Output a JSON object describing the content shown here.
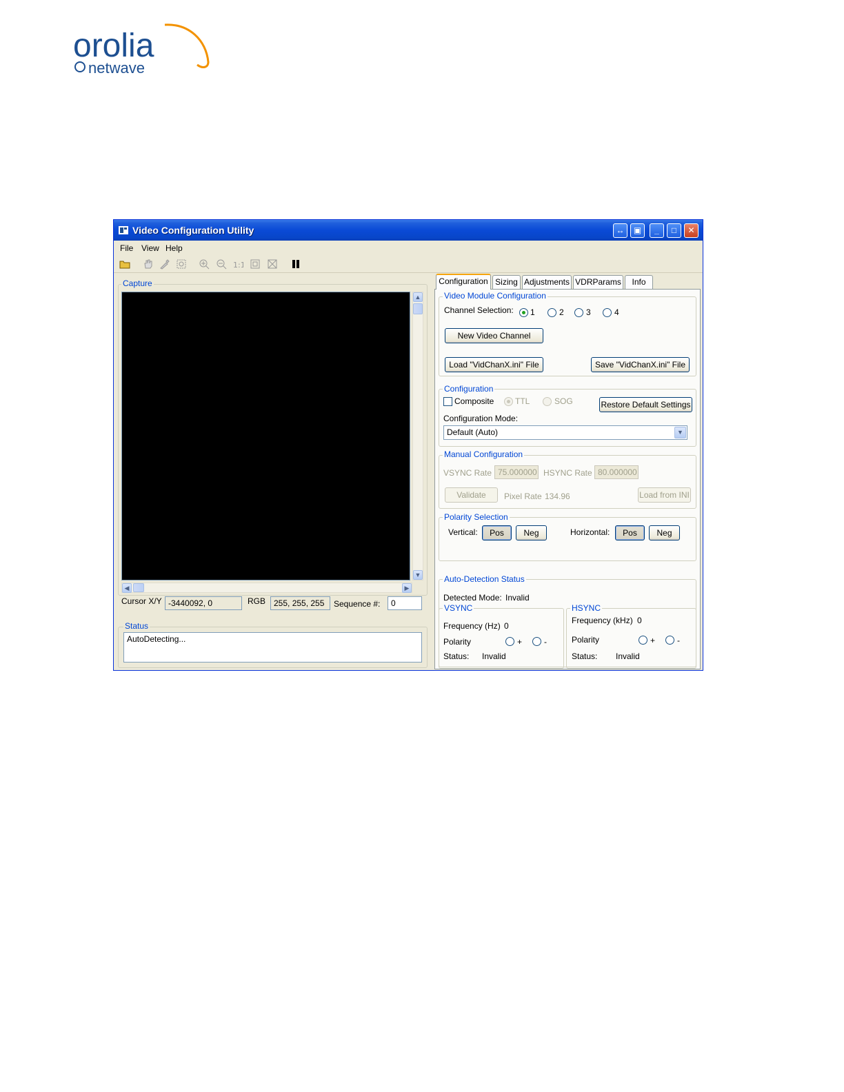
{
  "brand": {
    "name": "orolia",
    "subname": "netwave",
    "colors": {
      "blue": "#1d4f91",
      "orange": "#f39200"
    }
  },
  "window": {
    "title": "Video Configuration Utility",
    "controls": [
      "restore-arrows-icon",
      "window-icon",
      "minimize-icon",
      "maximize-icon",
      "close-icon"
    ]
  },
  "menu": {
    "file": "File",
    "view": "View",
    "help": "Help"
  },
  "toolbar": {
    "icons": [
      "open-folder-icon",
      "hand-pan-icon",
      "eyedropper-icon",
      "zoom-region-icon",
      "zoom-in-icon",
      "zoom-out-icon",
      "actual-size-icon",
      "fit-icon",
      "fullscreen-icon",
      "pause-icon"
    ]
  },
  "capture": {
    "label": "Capture",
    "cursor_label": "Cursor X/Y",
    "cursor_value": "-3440092, 0",
    "rgb_label": "RGB",
    "rgb_value": "255, 255, 255",
    "sequence_label": "Sequence #:",
    "sequence_value": "0"
  },
  "status": {
    "label": "Status",
    "text": "AutoDetecting..."
  },
  "tabs": [
    "Configuration",
    "Sizing",
    "Adjustments",
    "VDRParams",
    "Info"
  ],
  "video_module": {
    "label": "Video Module Configuration",
    "channel_label": "Channel Selection:",
    "channels": [
      "1",
      "2",
      "3",
      "4"
    ],
    "selected_channel": "1",
    "new_channel": "New Video Channel",
    "load_file": "Load \"VidChanX.ini\" File",
    "save_file": "Save \"VidChanX.ini\" File"
  },
  "configuration": {
    "label": "Configuration",
    "composite": "Composite",
    "ttl": "TTL",
    "sog": "SOG",
    "restore": "Restore Default Settings",
    "mode_label": "Configuration Mode:",
    "mode_value": "Default (Auto)"
  },
  "manual": {
    "label": "Manual Configuration",
    "vsync_label": "VSYNC Rate",
    "vsync_value": "75.000000",
    "hsync_label": "HSYNC Rate",
    "hsync_value": "80.000000",
    "validate": "Validate",
    "pixel_rate_label": "Pixel Rate",
    "pixel_rate_value": "134.96",
    "load_ini": "Load from INI"
  },
  "polarity": {
    "label": "Polarity Selection",
    "vertical_label": "Vertical:",
    "horizontal_label": "Horizontal:",
    "pos": "Pos",
    "neg": "Neg"
  },
  "auto_detection": {
    "label": "Auto-Detection Status",
    "detected_label": "Detected Mode:",
    "detected_value": "Invalid",
    "vsync": {
      "label": "VSYNC",
      "freq_label": "Frequency (Hz)",
      "freq_value": "0",
      "polarity_label": "Polarity",
      "plus": "+",
      "minus": "-",
      "status_label": "Status:",
      "status_value": "Invalid"
    },
    "hsync": {
      "label": "HSYNC",
      "freq_label": "Frequency (kHz)",
      "freq_value": "0",
      "polarity_label": "Polarity",
      "plus": "+",
      "minus": "-",
      "status_label": "Status:",
      "status_value": "Invalid"
    }
  }
}
